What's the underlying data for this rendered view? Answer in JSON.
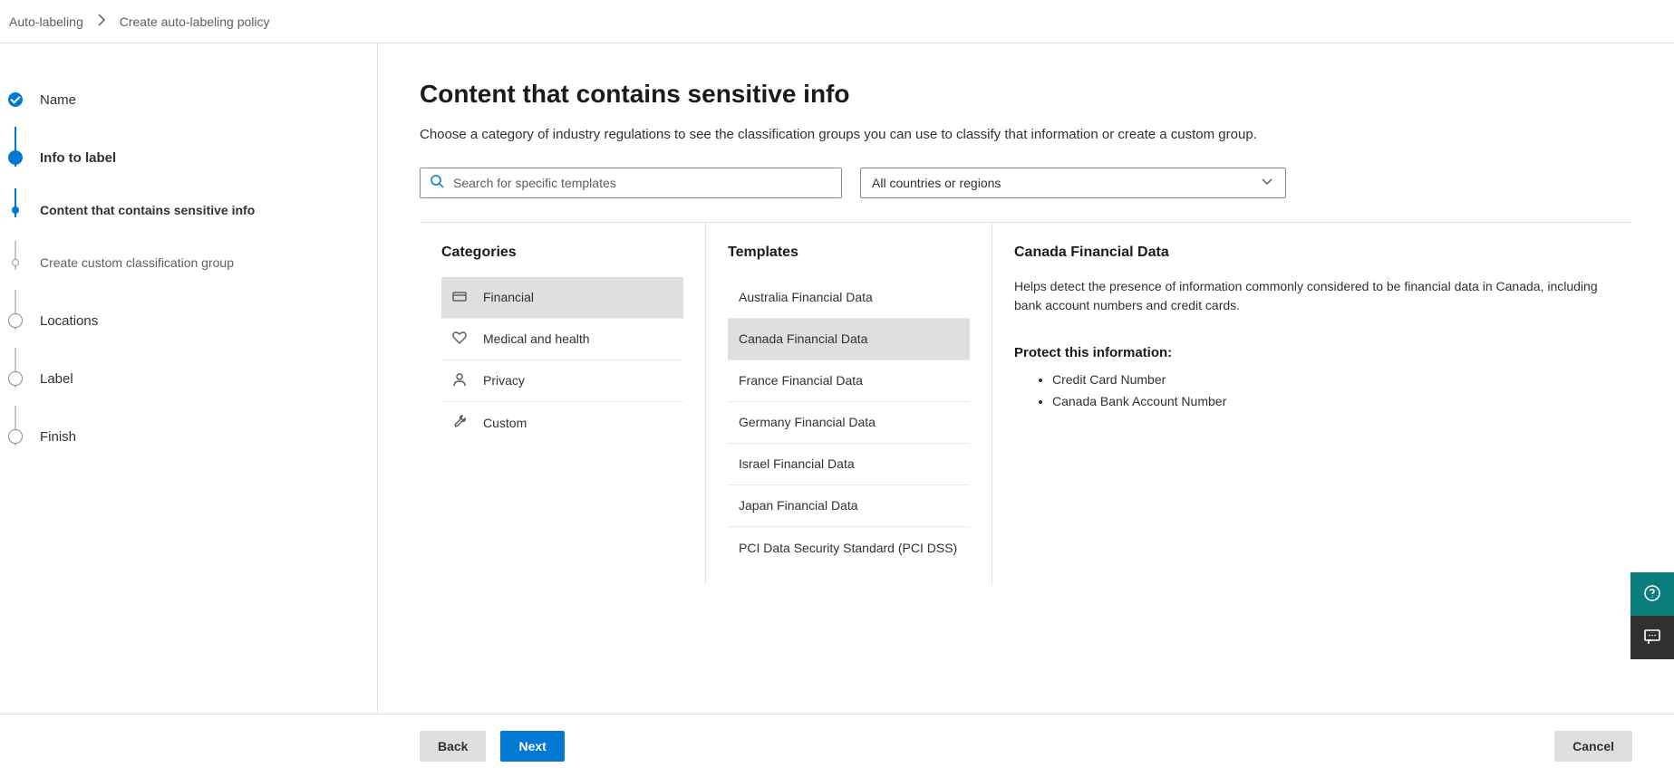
{
  "breadcrumb": {
    "parent": "Auto-labeling",
    "current": "Create auto-labeling policy"
  },
  "stepper": {
    "steps": [
      {
        "label": "Name"
      },
      {
        "label": "Info to label"
      },
      {
        "label": "Content that contains sensitive info"
      },
      {
        "label": "Create custom classification group"
      },
      {
        "label": "Locations"
      },
      {
        "label": "Label"
      },
      {
        "label": "Finish"
      }
    ]
  },
  "main": {
    "title": "Content that contains sensitive info",
    "description": "Choose a category of industry regulations to see the classification groups you can use to classify that information or create a custom group.",
    "search_placeholder": "Search for specific templates",
    "region_dropdown": "All countries or regions"
  },
  "categories": {
    "heading": "Categories",
    "items": [
      {
        "label": "Financial",
        "icon": "credit-card-icon",
        "selected": true
      },
      {
        "label": "Medical and health",
        "icon": "heart-icon",
        "selected": false
      },
      {
        "label": "Privacy",
        "icon": "person-icon",
        "selected": false
      },
      {
        "label": "Custom",
        "icon": "wrench-icon",
        "selected": false
      }
    ]
  },
  "templates": {
    "heading": "Templates",
    "items": [
      {
        "label": "Australia Financial Data",
        "selected": false
      },
      {
        "label": "Canada Financial Data",
        "selected": true
      },
      {
        "label": "France Financial Data",
        "selected": false
      },
      {
        "label": "Germany Financial Data",
        "selected": false
      },
      {
        "label": "Israel Financial Data",
        "selected": false
      },
      {
        "label": "Japan Financial Data",
        "selected": false
      },
      {
        "label": "PCI Data Security Standard (PCI DSS)",
        "selected": false
      }
    ]
  },
  "detail": {
    "title": "Canada Financial Data",
    "description": "Helps detect the presence of information commonly considered to be financial data in Canada, including bank account numbers and credit cards.",
    "protect_label": "Protect this information:",
    "protect_items": [
      "Credit Card Number",
      "Canada Bank Account Number"
    ]
  },
  "footer": {
    "back": "Back",
    "next": "Next",
    "cancel": "Cancel"
  }
}
